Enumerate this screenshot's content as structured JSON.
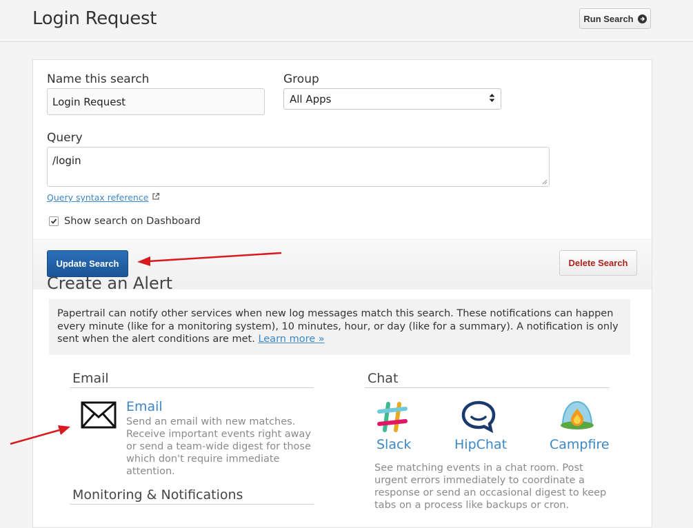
{
  "header": {
    "title": "Login Request",
    "run_search_label": "Run Search"
  },
  "form": {
    "name_label": "Name this search",
    "name_value": "Login Request",
    "group_label": "Group",
    "group_value": "All Apps",
    "query_label": "Query",
    "query_value": "/login",
    "syntax_link": "Query syntax reference",
    "dashboard_checkbox_label": "Show search on Dashboard",
    "dashboard_checked": true,
    "update_label": "Update Search",
    "delete_label": "Delete Search"
  },
  "alerts": {
    "title": "Create an Alert",
    "info_text": "Papertrail can notify other services when new log messages match this search. These notifications can happen every minute (like for a monitoring system), 10 minutes, hour, or day (like for a summary). A notification is only sent when the alert conditions are met.",
    "learn_more": "Learn more »",
    "email_section": "Email",
    "email_name": "Email",
    "email_desc": "Send an email with new matches. Receive important events right away or send a team-wide digest for those which don't require immediate attention.",
    "monitoring_section": "Monitoring & Notifications",
    "chat_section": "Chat",
    "chat_services": [
      {
        "name": "Slack",
        "icon": "slack-icon"
      },
      {
        "name": "HipChat",
        "icon": "hipchat-icon"
      },
      {
        "name": "Campfire",
        "icon": "campfire-icon"
      }
    ],
    "chat_desc": "See matching events in a chat room. Post urgent errors immediately to coordinate a response or send an occasional digest to keep tabs on a process like backups or cron."
  },
  "colors": {
    "accent": "#3b87c8",
    "primary_button": "#1f5fa6",
    "danger_text": "#b0201a",
    "annotation_arrow": "#d8191d"
  }
}
